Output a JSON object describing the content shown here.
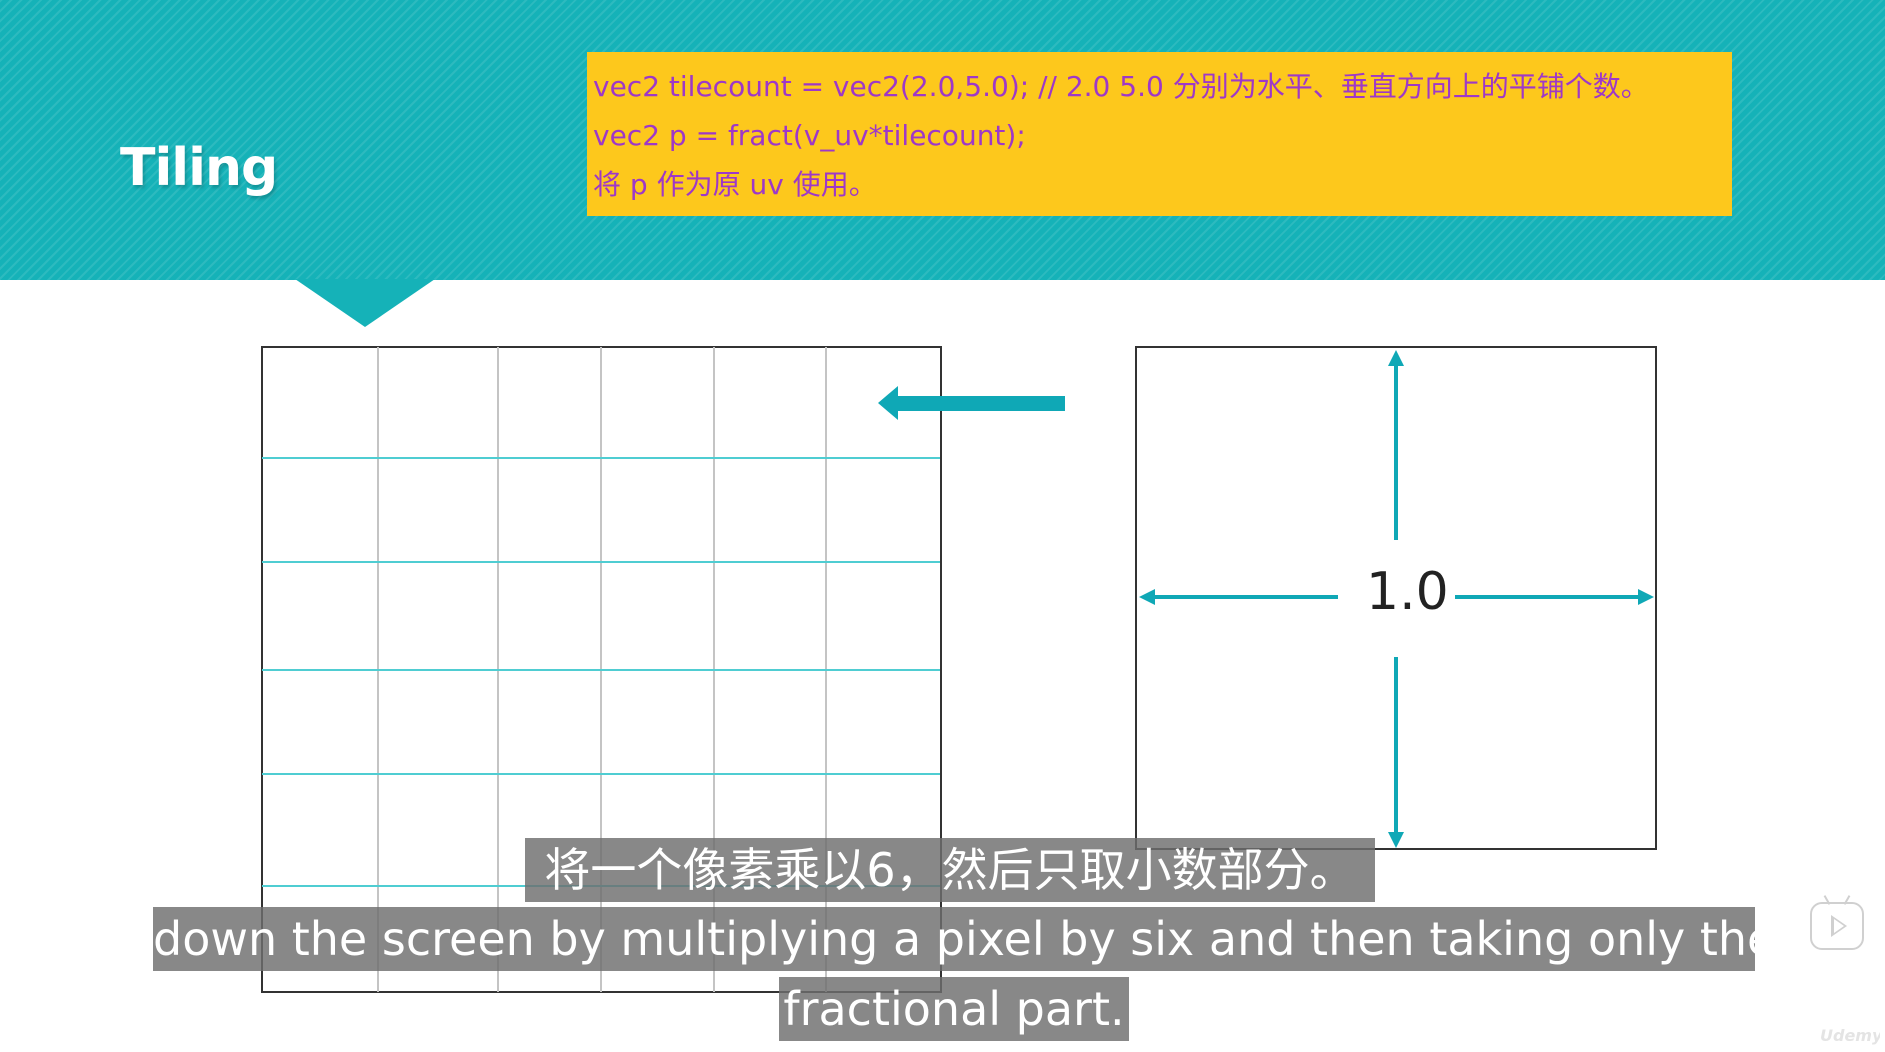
{
  "slide": {
    "title": "Tiling",
    "code_lines": [
      "vec2 tilecount = vec2(2.0,5.0);  // 2.0 5.0 分别为水平、垂直方向上的平铺个数。",
      "vec2 p = fract(v_uv*tilecount);",
      "将 p 作为原 uv 使用。"
    ]
  },
  "diagram": {
    "unit_label": "1.0"
  },
  "subtitles": {
    "zh": "将一个像素乘以6，然后只取小数部分。",
    "en_line1": "down the screen by multiplying a pixel by six and then taking only the",
    "en_line2": "fractional part."
  },
  "player": {
    "watermark": "Udemy"
  },
  "colors": {
    "header_teal": "#15b2b8",
    "grid_line_teal": "#4fcdd2",
    "arrow_teal": "#0fa8b6",
    "code_box_yellow": "#fdc81c",
    "code_text_purple": "#9e38c8",
    "subtitle_bg": "#6e6e6e"
  },
  "icons": {
    "player_button": "play-icon",
    "pointer_arrow": "left-arrow-icon"
  }
}
